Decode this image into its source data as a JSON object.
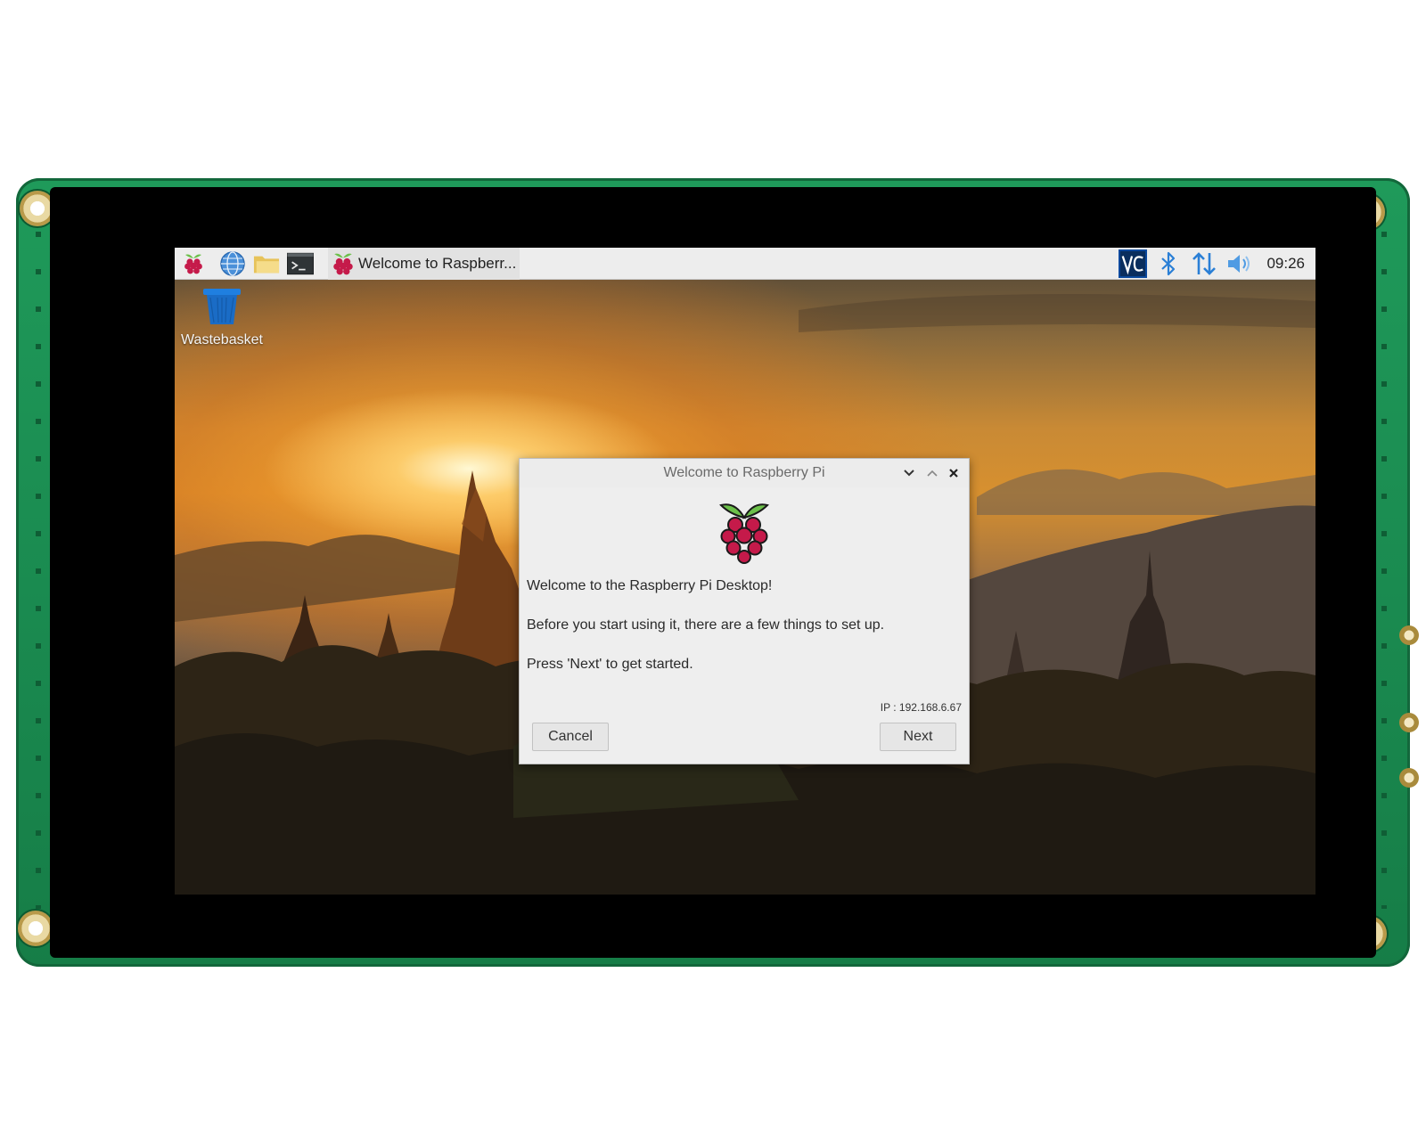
{
  "taskbar": {
    "launchers": [
      {
        "icon": "raspberry-menu-icon"
      },
      {
        "icon": "web-browser-icon"
      },
      {
        "icon": "file-manager-icon"
      },
      {
        "icon": "terminal-icon"
      }
    ],
    "task": {
      "icon": "raspberry-icon",
      "label": "Welcome to Raspberr..."
    },
    "tray": {
      "vnc_icon": "vnc-icon",
      "bluetooth_icon": "bluetooth-icon",
      "network_icon": "network-icon",
      "volume_icon": "volume-icon",
      "clock": "09:26"
    }
  },
  "desktop": {
    "icons": [
      {
        "label": "Wastebasket",
        "icon": "wastebasket-icon"
      }
    ]
  },
  "dialog": {
    "title": "Welcome to Raspberry Pi",
    "heading": "Welcome to the Raspberry Pi Desktop!",
    "line1": "Before you start using it, there are a few things to set up.",
    "line2": "Press 'Next' to get started.",
    "ip": "IP : 192.168.6.67",
    "cancel_label": "Cancel",
    "next_label": "Next"
  },
  "colors": {
    "pcb": "#1f9a5a",
    "taskbar": "#ededed",
    "raspberry": "#c51a4a",
    "leaf": "#6cc04a",
    "accent_blue": "#2a7fd6"
  }
}
